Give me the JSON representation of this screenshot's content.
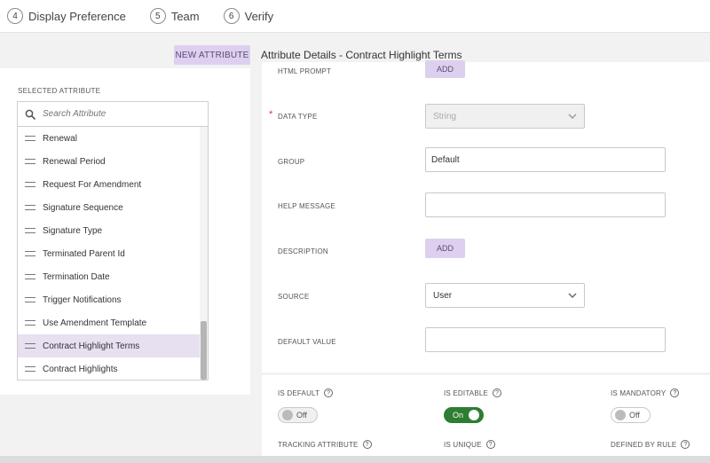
{
  "stepper": {
    "steps": [
      {
        "number": "4",
        "label": "Display Preference"
      },
      {
        "number": "5",
        "label": "Team"
      },
      {
        "number": "6",
        "label": "Verify"
      }
    ]
  },
  "header": {
    "new_attribute_label": "NEW ATTRIBUTE",
    "title": "Attribute Details - Contract Highlight Terms"
  },
  "left_panel": {
    "section_label": "SELECTED ATTRIBUTE",
    "search_placeholder": "Search Attribute",
    "items": [
      "Renewal",
      "Renewal Period",
      "Request For Amendment",
      "Signature Sequence",
      "Signature Type",
      "Terminated Parent Id",
      "Termination Date",
      "Trigger Notifications",
      "Use Amendment Template",
      "Contract Highlight Terms",
      "Contract Highlights"
    ],
    "selected_item": "Contract Highlight Terms"
  },
  "form": {
    "html_prompt": {
      "label": "HTML PROMPT",
      "button": "ADD"
    },
    "data_type": {
      "label": "DATA TYPE",
      "value": "String",
      "required_marker": "*"
    },
    "group": {
      "label": "GROUP",
      "value": "Default"
    },
    "help_message": {
      "label": "HELP MESSAGE",
      "value": ""
    },
    "description": {
      "label": "DESCRIPTION",
      "button": "ADD"
    },
    "source": {
      "label": "SOURCE",
      "value": "User"
    },
    "default_value": {
      "label": "DEFAULT VALUE",
      "value": ""
    }
  },
  "toggles": {
    "is_default": {
      "label": "IS DEFAULT",
      "state": "Off"
    },
    "is_editable": {
      "label": "IS EDITABLE",
      "state": "On"
    },
    "is_mandatory": {
      "label": "IS MANDATORY",
      "state": "Off"
    },
    "tracking_attribute": {
      "label": "TRACKING ATTRIBUTE"
    },
    "is_unique": {
      "label": "IS UNIQUE"
    },
    "defined_by_rule": {
      "label": "DEFINED BY RULE"
    },
    "help_glyph": "?"
  },
  "colors": {
    "accent_lavender": "#ddd0ef",
    "selected_row": "#e7e0f1",
    "toggle_on": "#2e7d32"
  }
}
